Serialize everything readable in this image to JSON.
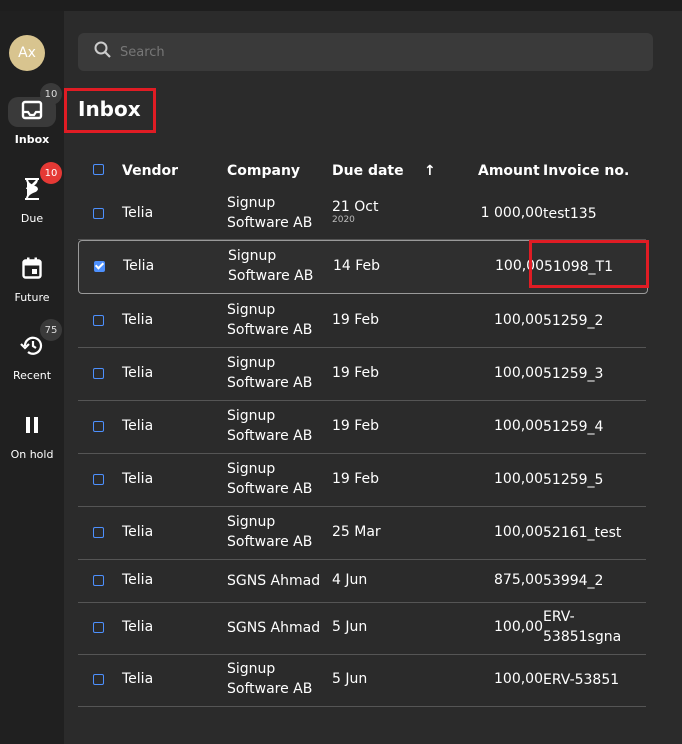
{
  "sidebar": {
    "avatar": "Ax",
    "items": [
      {
        "label": "Inbox",
        "badge": "10"
      },
      {
        "label": "Due",
        "badge": "10"
      },
      {
        "label": "Future",
        "badge": ""
      },
      {
        "label": "Recent",
        "badge": "75"
      },
      {
        "label": "On hold",
        "badge": ""
      }
    ]
  },
  "search": {
    "placeholder": "Search"
  },
  "page_title": "Inbox",
  "table": {
    "headers": {
      "vendor": "Vendor",
      "company": "Company",
      "due_date": "Due date",
      "sort": "↑",
      "amount": "Amount",
      "invoice": "Invoice no."
    },
    "rows": [
      {
        "vendor": "Telia",
        "company1": "Signup",
        "company2": "Software AB",
        "due": "21 Oct",
        "year": "2020",
        "amount": "1 000,00",
        "inv1": "test135",
        "inv2": "",
        "checked": false
      },
      {
        "vendor": "Telia",
        "company1": "Signup",
        "company2": "Software AB",
        "due": "14 Feb",
        "year": "",
        "amount": "100,00",
        "inv1": "51098_T1",
        "inv2": "",
        "checked": true
      },
      {
        "vendor": "Telia",
        "company1": "Signup",
        "company2": "Software AB",
        "due": "19 Feb",
        "year": "",
        "amount": "100,00",
        "inv1": "51259_2",
        "inv2": "",
        "checked": false
      },
      {
        "vendor": "Telia",
        "company1": "Signup",
        "company2": "Software AB",
        "due": "19 Feb",
        "year": "",
        "amount": "100,00",
        "inv1": "51259_3",
        "inv2": "",
        "checked": false
      },
      {
        "vendor": "Telia",
        "company1": "Signup",
        "company2": "Software AB",
        "due": "19 Feb",
        "year": "",
        "amount": "100,00",
        "inv1": "51259_4",
        "inv2": "",
        "checked": false
      },
      {
        "vendor": "Telia",
        "company1": "Signup",
        "company2": "Software AB",
        "due": "19 Feb",
        "year": "",
        "amount": "100,00",
        "inv1": "51259_5",
        "inv2": "",
        "checked": false
      },
      {
        "vendor": "Telia",
        "company1": "Signup",
        "company2": "Software AB",
        "due": "25 Mar",
        "year": "",
        "amount": "100,00",
        "inv1": "52161_test",
        "inv2": "",
        "checked": false
      },
      {
        "vendor": "Telia",
        "company1": "SGNS Ahmad",
        "company2": "",
        "due": "4 Jun",
        "year": "",
        "amount": "875,00",
        "inv1": "53994_2",
        "inv2": "",
        "checked": false
      },
      {
        "vendor": "Telia",
        "company1": "SGNS Ahmad",
        "company2": "",
        "due": "5 Jun",
        "year": "",
        "amount": "100,00",
        "inv1": "ERV-",
        "inv2": "53851sgna",
        "checked": false
      },
      {
        "vendor": "Telia",
        "company1": "Signup",
        "company2": "Software AB",
        "due": "5 Jun",
        "year": "",
        "amount": "100,00",
        "inv1": "ERV-53851",
        "inv2": "",
        "checked": false
      }
    ]
  },
  "colors": {
    "accent": "#4d90fe",
    "highlight": "#e01c24",
    "badge_red": "#e53935"
  }
}
